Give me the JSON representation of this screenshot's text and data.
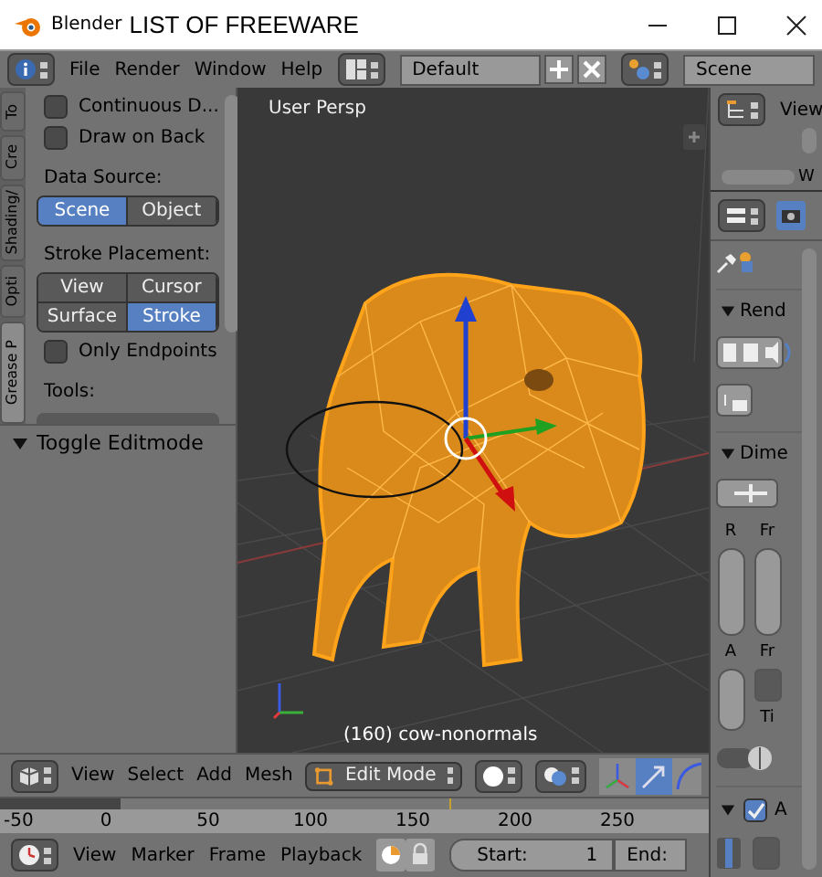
{
  "window": {
    "app_name": "Blender",
    "title": "LIST OF FREEWARE"
  },
  "menu_bar": {
    "menus": [
      "File",
      "Render",
      "Window",
      "Help"
    ],
    "screen_layout": "Default",
    "scene": "Scene"
  },
  "tool_shelf": {
    "tabs": [
      {
        "label": "To",
        "selected": false
      },
      {
        "label": "Cre",
        "selected": false
      },
      {
        "label": "Shading/",
        "selected": false
      },
      {
        "label": "Opti",
        "selected": false
      },
      {
        "label": "Grease P",
        "selected": true
      }
    ],
    "options": [
      {
        "label": "Continuous D...",
        "checked": false
      },
      {
        "label": "Draw on Back",
        "checked": false
      }
    ],
    "data_source": {
      "label": "Data Source:",
      "options": [
        {
          "label": "Scene",
          "selected": true
        },
        {
          "label": "Object",
          "selected": false
        }
      ]
    },
    "stroke_placement": {
      "label": "Stroke Placement:",
      "options": [
        {
          "label": "View",
          "selected": false
        },
        {
          "label": "Cursor",
          "selected": false
        },
        {
          "label": "Surface",
          "selected": false
        },
        {
          "label": "Stroke",
          "selected": true
        }
      ]
    },
    "only_endpoints": {
      "label": "Only Endpoints",
      "checked": false
    },
    "tools_label": "Tools:"
  },
  "operator_panel": {
    "title": "Toggle Editmode",
    "expanded": true
  },
  "viewport": {
    "view_name": "User Persp",
    "object_info": "(160) cow-nonormals"
  },
  "viewport_header": {
    "menus": [
      "View",
      "Select",
      "Add",
      "Mesh"
    ],
    "mode": "Edit Mode"
  },
  "timeline": {
    "ruler_labels": [
      "-50",
      "0",
      "50",
      "100",
      "150",
      "200",
      "250"
    ],
    "menus": [
      "View",
      "Marker",
      "Frame",
      "Playback"
    ],
    "start_label": "Start:",
    "start_value": "1",
    "end_label": "End:"
  },
  "outliner": {
    "view_label": "View",
    "cut_label": "W"
  },
  "properties": {
    "sections": [
      {
        "title": "Rend",
        "expanded": true
      },
      {
        "title": "Dime",
        "expanded": true
      }
    ],
    "labels": [
      "R",
      "Fr",
      "A",
      "Fr",
      "Ti"
    ],
    "last_section": {
      "title": "A",
      "checked": true,
      "expanded": true
    }
  }
}
